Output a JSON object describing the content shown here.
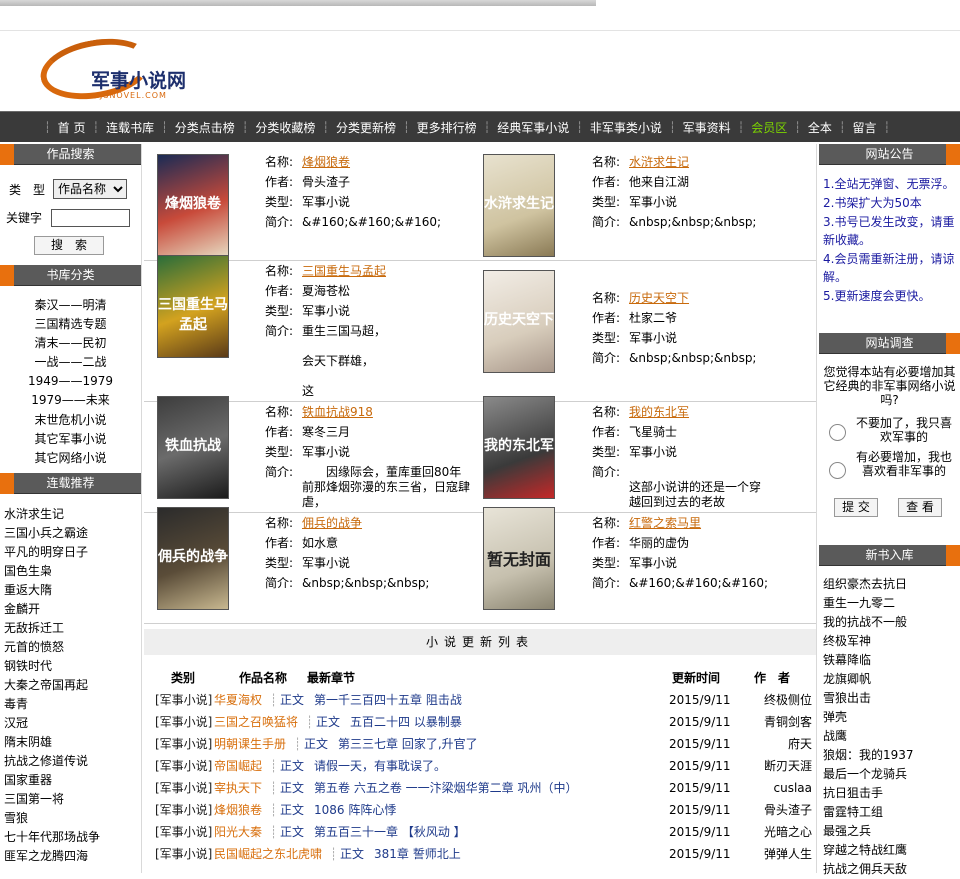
{
  "site": {
    "logo_name": "军事小说网",
    "logo_sub": "JSNOVEL.COM"
  },
  "nav": {
    "items": [
      {
        "label": "首 页"
      },
      {
        "label": "连载书库"
      },
      {
        "label": "分类点击榜"
      },
      {
        "label": "分类收藏榜"
      },
      {
        "label": "分类更新榜"
      },
      {
        "label": "更多排行榜"
      },
      {
        "label": "经典军事小说"
      },
      {
        "label": "非军事类小说"
      },
      {
        "label": "军事资料"
      },
      {
        "label": "会员区",
        "active": true
      },
      {
        "label": "全本"
      },
      {
        "label": "留言"
      }
    ]
  },
  "search": {
    "title": "作品搜索",
    "type_label": "类　型",
    "type_value": "作品名称",
    "keyword_label": "关键字",
    "button": "搜　索"
  },
  "categories": {
    "title": "书库分类",
    "items": [
      "秦汉——明清",
      "三国精选专题",
      "清末——民初",
      "一战——二战",
      "1949——1979",
      "1979——未来",
      "末世危机小说",
      "其它军事小说",
      "其它网络小说"
    ]
  },
  "recommend": {
    "title": "连载推荐",
    "items": [
      "水浒求生记",
      "三国小兵之霸途",
      "平凡的明穿日子",
      "国色生枭",
      "重返大隋",
      "金麟开",
      "无敌拆迁工",
      "元首的愤怒",
      "钢铁时代",
      "大秦之帝国再起",
      "毒青",
      "汉冠",
      "隋末阴雄",
      "抗战之修道传说",
      "国家重器",
      "三国第一将",
      "雪狼",
      "七十年代那场战争",
      "匪军之龙腾四海"
    ]
  },
  "labels": {
    "name": "名称:",
    "author": "作者:",
    "type": "类型:",
    "intro": "简介:"
  },
  "books": [
    {
      "title": "烽烟狼卷",
      "author": "骨头渣子",
      "type": "军事小说",
      "intro": "&#160;&#160;&#160;",
      "cover_text": "烽烟狼卷"
    },
    {
      "title": "水浒求生记",
      "author": "他来自江湖",
      "type": "军事小说",
      "intro": "&nbsp;&nbsp;&nbsp;",
      "cover_text": "水浒求生记"
    },
    {
      "title": "三国重生马孟起",
      "author": "夏海苍松",
      "type": "军事小说",
      "intro": "重生三国马超，",
      "intro2": "会天下群雄，",
      "intro3": "这",
      "cover_text": "三国重生马孟起"
    },
    {
      "title": "历史天空下",
      "author": "杜家二爷",
      "type": "军事小说",
      "intro": "&nbsp;&nbsp;&nbsp;",
      "cover_text": "历史天空下"
    },
    {
      "title": "铁血抗战918",
      "author": "寒冬三月",
      "type": "军事小说",
      "intro": "　　因缘际会，董库重回80年前那烽烟弥漫的东三省，日寇肆虐，",
      "cover_text": "铁血抗战"
    },
    {
      "title": "我的东北军",
      "author": "飞星骑士",
      "type": "军事小说",
      "intro": "这部小说讲的还是一个穿越回到过去的老故",
      "cover_text": "我的东北军"
    },
    {
      "title": "佣兵的战争",
      "author": "如水意",
      "type": "军事小说",
      "intro": "&nbsp;&nbsp;&nbsp;",
      "cover_text": "佣兵的战争"
    },
    {
      "title": "红警之索马里",
      "author": "华丽的虚伪",
      "type": "军事小说",
      "intro": "&#160;&#160;&#160;",
      "cover_text": "暂无封面"
    }
  ],
  "updates": {
    "title": "小说更新列表",
    "cols": {
      "cat": "类别",
      "name": "作品名称",
      "chapter": "最新章节",
      "time": "更新时间",
      "author": "作　者"
    },
    "rows": [
      {
        "cat": "[军事小说]",
        "book": "华夏海权",
        "vol": "正文",
        "ch": "第一千三百四十五章 阻击战",
        "date": "2015/9/11",
        "author": "终极侧位"
      },
      {
        "cat": "[军事小说]",
        "book": "三国之召唤猛将",
        "vol": "正文",
        "ch": "五百二十四 以暴制暴",
        "date": "2015/9/11",
        "author": "青铜剑客"
      },
      {
        "cat": "[军事小说]",
        "book": "明朝课生手册",
        "vol": "正文",
        "ch": "第三三七章 回家了,升官了",
        "date": "2015/9/11",
        "author": "府天"
      },
      {
        "cat": "[军事小说]",
        "book": "帝国崛起",
        "vol": "正文",
        "ch": "请假一天，有事耽误了。",
        "date": "2015/9/11",
        "author": "断刃天涯"
      },
      {
        "cat": "[军事小说]",
        "book": "宰执天下",
        "vol": "正文",
        "ch": "第五卷 六五之卷 一一汴梁烟华第二章 巩州（中）",
        "date": "2015/9/11",
        "author": "cuslaa"
      },
      {
        "cat": "[军事小说]",
        "book": "烽烟狼卷",
        "vol": "正文",
        "ch": "1086 阵阵心悸",
        "date": "2015/9/11",
        "author": "骨头渣子"
      },
      {
        "cat": "[军事小说]",
        "book": "阳光大秦",
        "vol": "正文",
        "ch": "第五百三十一章 【秋风动 】",
        "date": "2015/9/11",
        "author": "光暗之心"
      },
      {
        "cat": "[军事小说]",
        "book": "民国崛起之东北虎啸",
        "vol": "正文",
        "ch": "381章 誓师北上",
        "date": "2015/9/11",
        "author": "弹弹人生"
      }
    ]
  },
  "notice": {
    "title": "网站公告",
    "items": [
      "1.全站无弹窗、无票浮。",
      "2.书架扩大为50本",
      "3.书号已发生改变，请重新收藏。",
      "4.会员需重新注册，请谅解。",
      "5.更新速度会更快。"
    ]
  },
  "survey": {
    "title": "网站调查",
    "question": "您觉得本站有必要增加其它经典的非军事网络小说吗?",
    "opt1": "不要加了，我只喜欢军事的",
    "opt2": "有必要增加，我也喜欢看非军事的",
    "submit": "提 交",
    "view": "查 看"
  },
  "newbooks": {
    "title": "新书入库",
    "items": [
      "组织豪杰去抗日",
      "重生一九零二",
      "我的抗战不一般",
      "终极军神",
      "铁幕降临",
      "龙旗卿帆",
      "雪狼出击",
      "弹壳",
      "战鹰",
      "狼烟：我的1937",
      "最后一个龙骑兵",
      "抗日狙击手",
      "雷霆特工组",
      "最强之兵",
      "穿越之特战红鹰",
      "抗战之佣兵天敌"
    ]
  }
}
